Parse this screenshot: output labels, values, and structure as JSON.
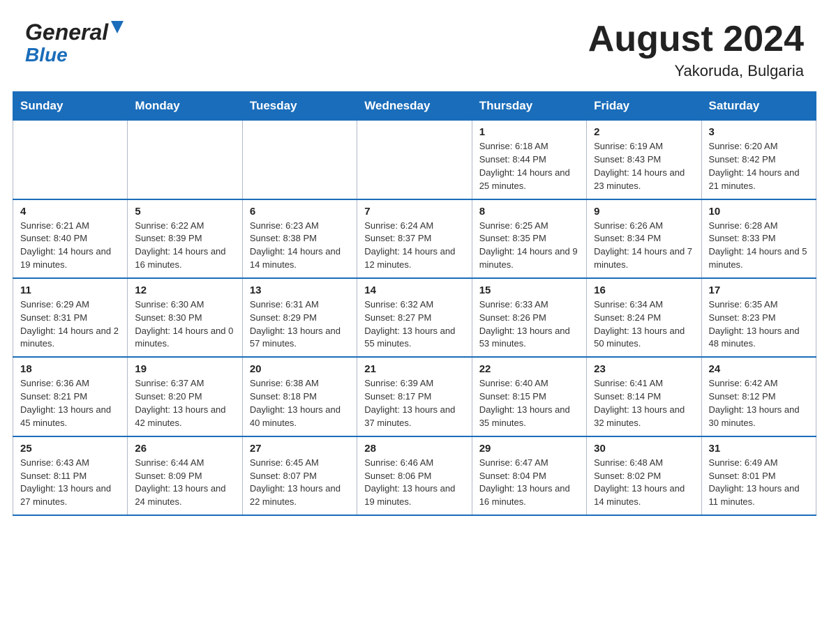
{
  "header": {
    "logo_line1": "General",
    "logo_line2": "Blue",
    "month_year": "August 2024",
    "location": "Yakoruda, Bulgaria"
  },
  "days_of_week": [
    "Sunday",
    "Monday",
    "Tuesday",
    "Wednesday",
    "Thursday",
    "Friday",
    "Saturday"
  ],
  "weeks": [
    [
      {
        "day": "",
        "info": ""
      },
      {
        "day": "",
        "info": ""
      },
      {
        "day": "",
        "info": ""
      },
      {
        "day": "",
        "info": ""
      },
      {
        "day": "1",
        "info": "Sunrise: 6:18 AM\nSunset: 8:44 PM\nDaylight: 14 hours and 25 minutes."
      },
      {
        "day": "2",
        "info": "Sunrise: 6:19 AM\nSunset: 8:43 PM\nDaylight: 14 hours and 23 minutes."
      },
      {
        "day": "3",
        "info": "Sunrise: 6:20 AM\nSunset: 8:42 PM\nDaylight: 14 hours and 21 minutes."
      }
    ],
    [
      {
        "day": "4",
        "info": "Sunrise: 6:21 AM\nSunset: 8:40 PM\nDaylight: 14 hours and 19 minutes."
      },
      {
        "day": "5",
        "info": "Sunrise: 6:22 AM\nSunset: 8:39 PM\nDaylight: 14 hours and 16 minutes."
      },
      {
        "day": "6",
        "info": "Sunrise: 6:23 AM\nSunset: 8:38 PM\nDaylight: 14 hours and 14 minutes."
      },
      {
        "day": "7",
        "info": "Sunrise: 6:24 AM\nSunset: 8:37 PM\nDaylight: 14 hours and 12 minutes."
      },
      {
        "day": "8",
        "info": "Sunrise: 6:25 AM\nSunset: 8:35 PM\nDaylight: 14 hours and 9 minutes."
      },
      {
        "day": "9",
        "info": "Sunrise: 6:26 AM\nSunset: 8:34 PM\nDaylight: 14 hours and 7 minutes."
      },
      {
        "day": "10",
        "info": "Sunrise: 6:28 AM\nSunset: 8:33 PM\nDaylight: 14 hours and 5 minutes."
      }
    ],
    [
      {
        "day": "11",
        "info": "Sunrise: 6:29 AM\nSunset: 8:31 PM\nDaylight: 14 hours and 2 minutes."
      },
      {
        "day": "12",
        "info": "Sunrise: 6:30 AM\nSunset: 8:30 PM\nDaylight: 14 hours and 0 minutes."
      },
      {
        "day": "13",
        "info": "Sunrise: 6:31 AM\nSunset: 8:29 PM\nDaylight: 13 hours and 57 minutes."
      },
      {
        "day": "14",
        "info": "Sunrise: 6:32 AM\nSunset: 8:27 PM\nDaylight: 13 hours and 55 minutes."
      },
      {
        "day": "15",
        "info": "Sunrise: 6:33 AM\nSunset: 8:26 PM\nDaylight: 13 hours and 53 minutes."
      },
      {
        "day": "16",
        "info": "Sunrise: 6:34 AM\nSunset: 8:24 PM\nDaylight: 13 hours and 50 minutes."
      },
      {
        "day": "17",
        "info": "Sunrise: 6:35 AM\nSunset: 8:23 PM\nDaylight: 13 hours and 48 minutes."
      }
    ],
    [
      {
        "day": "18",
        "info": "Sunrise: 6:36 AM\nSunset: 8:21 PM\nDaylight: 13 hours and 45 minutes."
      },
      {
        "day": "19",
        "info": "Sunrise: 6:37 AM\nSunset: 8:20 PM\nDaylight: 13 hours and 42 minutes."
      },
      {
        "day": "20",
        "info": "Sunrise: 6:38 AM\nSunset: 8:18 PM\nDaylight: 13 hours and 40 minutes."
      },
      {
        "day": "21",
        "info": "Sunrise: 6:39 AM\nSunset: 8:17 PM\nDaylight: 13 hours and 37 minutes."
      },
      {
        "day": "22",
        "info": "Sunrise: 6:40 AM\nSunset: 8:15 PM\nDaylight: 13 hours and 35 minutes."
      },
      {
        "day": "23",
        "info": "Sunrise: 6:41 AM\nSunset: 8:14 PM\nDaylight: 13 hours and 32 minutes."
      },
      {
        "day": "24",
        "info": "Sunrise: 6:42 AM\nSunset: 8:12 PM\nDaylight: 13 hours and 30 minutes."
      }
    ],
    [
      {
        "day": "25",
        "info": "Sunrise: 6:43 AM\nSunset: 8:11 PM\nDaylight: 13 hours and 27 minutes."
      },
      {
        "day": "26",
        "info": "Sunrise: 6:44 AM\nSunset: 8:09 PM\nDaylight: 13 hours and 24 minutes."
      },
      {
        "day": "27",
        "info": "Sunrise: 6:45 AM\nSunset: 8:07 PM\nDaylight: 13 hours and 22 minutes."
      },
      {
        "day": "28",
        "info": "Sunrise: 6:46 AM\nSunset: 8:06 PM\nDaylight: 13 hours and 19 minutes."
      },
      {
        "day": "29",
        "info": "Sunrise: 6:47 AM\nSunset: 8:04 PM\nDaylight: 13 hours and 16 minutes."
      },
      {
        "day": "30",
        "info": "Sunrise: 6:48 AM\nSunset: 8:02 PM\nDaylight: 13 hours and 14 minutes."
      },
      {
        "day": "31",
        "info": "Sunrise: 6:49 AM\nSunset: 8:01 PM\nDaylight: 13 hours and 11 minutes."
      }
    ]
  ]
}
